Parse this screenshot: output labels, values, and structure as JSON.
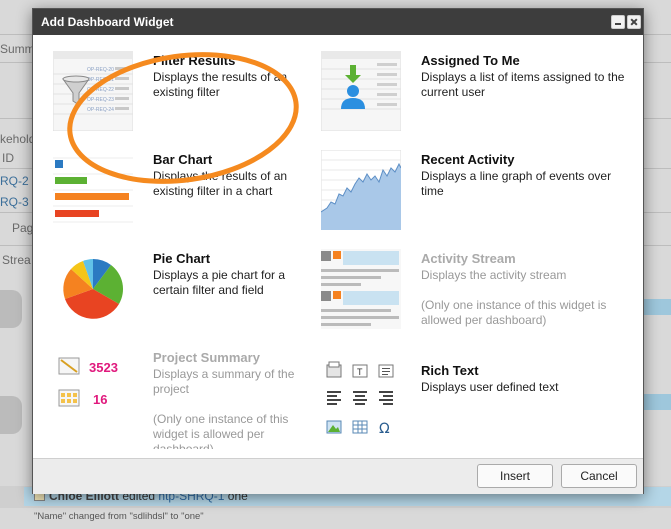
{
  "background": {
    "left_labels": [
      "Summ",
      "kehold",
      "ID",
      "RQ-2",
      "RQ-3",
      "Pag",
      "Strea"
    ],
    "footer_user": "Chloe Elliott",
    "footer_action": "edited",
    "footer_issue": "htp-SHRQ-1",
    "footer_suffix": "one",
    "footer_note": "\"Name\" changed from \"sdlihdsl\" to \"one\""
  },
  "dialog": {
    "title": "Add Dashboard Widget",
    "widgets": [
      {
        "title": "Filter Results",
        "description": "Displays the results of an existing filter",
        "note": "",
        "enabled": true,
        "thumb": "filter-results-thumb"
      },
      {
        "title": "Assigned To Me",
        "description": "Displays a list of items assigned to the current user",
        "note": "",
        "enabled": true,
        "thumb": "assigned-to-me-thumb"
      },
      {
        "title": "Bar Chart",
        "description": "Displays the results of an existing filter in a chart",
        "note": "",
        "enabled": true,
        "thumb": "bar-chart-thumb"
      },
      {
        "title": "Recent Activity",
        "description": "Displays a line graph of events over time",
        "note": "",
        "enabled": true,
        "thumb": "recent-activity-thumb"
      },
      {
        "title": "Pie Chart",
        "description": "Displays a pie chart for a certain filter and field",
        "note": "",
        "enabled": true,
        "thumb": "pie-chart-thumb"
      },
      {
        "title": "Activity Stream",
        "description": "Displays the activity stream",
        "note": "(Only one instance of this widget is allowed per dashboard)",
        "enabled": false,
        "thumb": "activity-stream-thumb"
      },
      {
        "title": "Project Summary",
        "description": "Displays a summary of the project",
        "note": "(Only one instance of this widget is allowed per dashboard)",
        "enabled": false,
        "thumb": "project-summary-thumb"
      },
      {
        "title": "Rich Text",
        "description": "Displays user defined text",
        "note": "",
        "enabled": true,
        "thumb": "rich-text-thumb"
      }
    ],
    "thumb_text": {
      "filter_ids": [
        "OP-REQ-20",
        "OP-REQ-21",
        "OP-REQ-22",
        "OP-REQ-23",
        "OP-REQ-24"
      ],
      "project_summary_top": "3523",
      "project_summary_bottom": "16"
    },
    "buttons": {
      "insert": "Insert",
      "cancel": "Cancel"
    }
  },
  "colors": {
    "annotation": "#f58a1f",
    "bar_blue": "#2b7ac2",
    "bar_green": "#5cb133",
    "bar_orange": "#f58220",
    "bar_red": "#e84422",
    "pink_number": "#e0197d"
  }
}
